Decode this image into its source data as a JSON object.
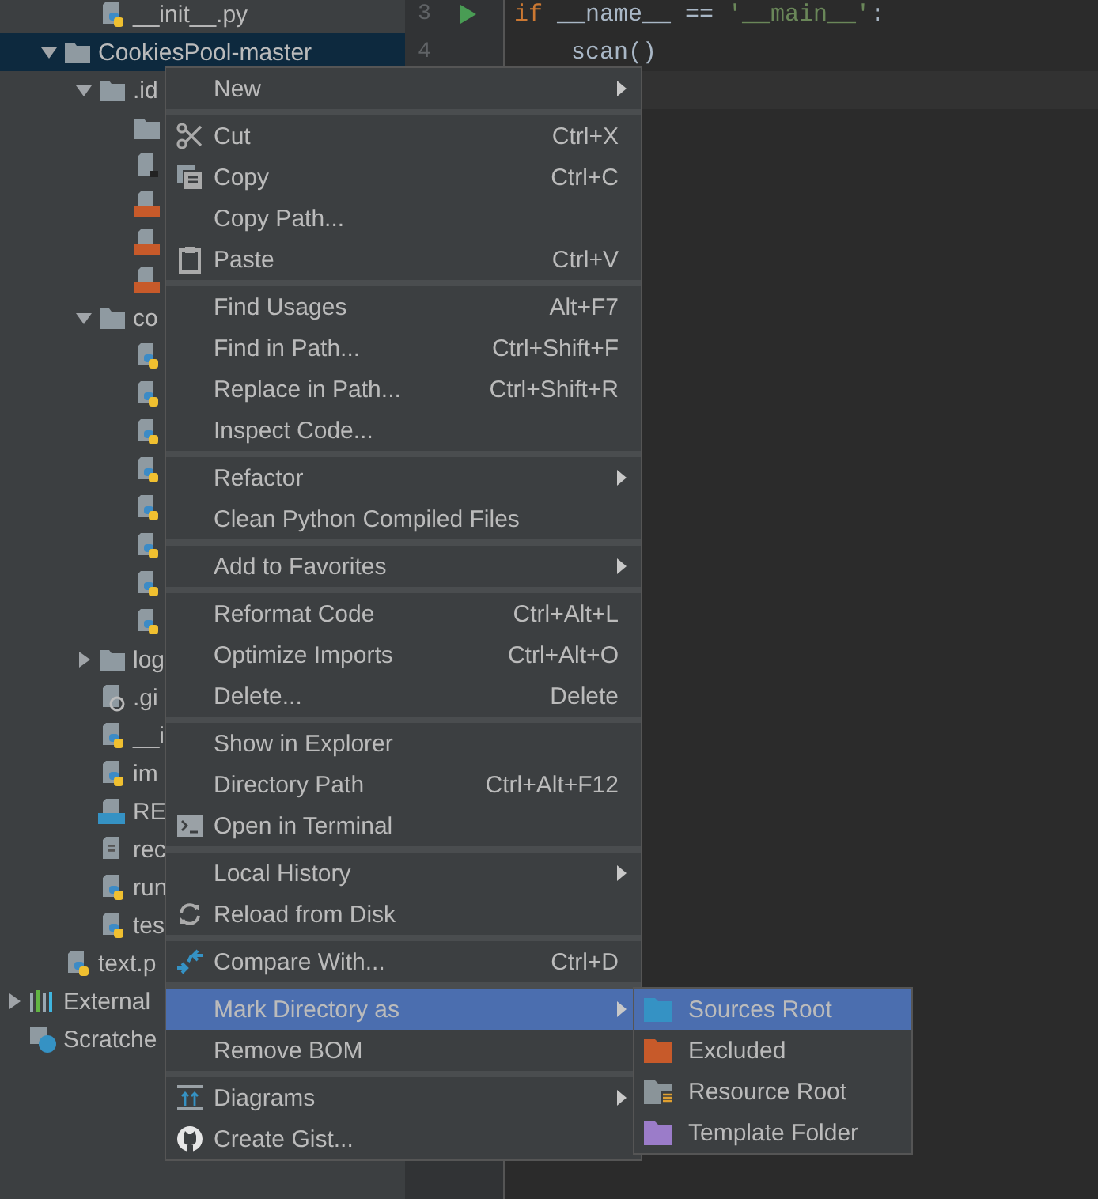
{
  "tree": {
    "items": [
      {
        "children": [
          {
            "children": [
              {
                "label": "__init__.py",
                "kind": "py"
              }
            ]
          },
          {
            "label": "CookiesPool-master",
            "kind": "folder",
            "expanded": true,
            "selected": true,
            "children": [
              {
                "label": ".id",
                "kind": "folder",
                "expanded": true,
                "selected": false,
                "children": [
                  {
                    "kind": "folder",
                    "selected": false
                  },
                  {
                    "kind": "file",
                    "selected": false
                  },
                  {
                    "kind": "xml",
                    "selected": false
                  },
                  {
                    "kind": "xml",
                    "selected": false
                  },
                  {
                    "kind": "xml",
                    "selected": false
                  }
                ]
              },
              {
                "label": "co",
                "kind": "folder",
                "expanded": true,
                "selected": false,
                "children": [
                  {
                    "kind": "py",
                    "selected": false
                  },
                  {
                    "kind": "py",
                    "selected": false
                  },
                  {
                    "kind": "py",
                    "selected": false
                  },
                  {
                    "kind": "py",
                    "selected": false
                  },
                  {
                    "kind": "py",
                    "selected": false
                  },
                  {
                    "kind": "py",
                    "selected": false
                  },
                  {
                    "kind": "py",
                    "selected": false
                  },
                  {
                    "kind": "py",
                    "selected": false
                  }
                ]
              },
              {
                "label": "log",
                "kind": "folder",
                "expanded": false,
                "selected": false
              },
              {
                "label": ".gi",
                "kind": "ignore",
                "selected": false
              },
              {
                "label": "__i",
                "kind": "py",
                "selected": false
              },
              {
                "label": "im",
                "kind": "py",
                "selected": false
              },
              {
                "label": "RE",
                "kind": "md",
                "selected": false
              },
              {
                "label": "rec",
                "kind": "text",
                "selected": false
              },
              {
                "label": "run",
                "kind": "py",
                "selected": false
              },
              {
                "label": "tes",
                "kind": "py",
                "selected": false
              }
            ]
          },
          {
            "label": "text.p",
            "kind": "py",
            "selected": false
          }
        ]
      },
      {
        "label": "External",
        "kind": "library",
        "expanded": false,
        "selected": false
      },
      {
        "label": "Scratche",
        "kind": "scratch",
        "selected": false
      }
    ]
  },
  "editor": {
    "lines": [
      {
        "number": "3",
        "run": true,
        "tokens": [
          {
            "text": "if",
            "kind": "keyword"
          },
          {
            "text": " __name__ ",
            "kind": "name"
          },
          {
            "text": "==",
            "kind": "op"
          },
          {
            "text": " '__main__'",
            "kind": "string"
          },
          {
            "text": ":",
            "kind": "op"
          }
        ]
      },
      {
        "number": "4",
        "tokens": [
          {
            "text": "    scan",
            "kind": "name"
          },
          {
            "text": "()",
            "kind": "op"
          }
        ]
      },
      {
        "current": true
      }
    ]
  },
  "menu": {
    "groups": [
      [
        {
          "label": "New",
          "submenu": true,
          "selected": false
        }
      ],
      [
        {
          "label": "Cut",
          "shortcut": "Ctrl+X",
          "kind": "cut",
          "selected": false
        },
        {
          "label": "Copy",
          "shortcut": "Ctrl+C",
          "kind": "copy",
          "selected": false
        },
        {
          "label": "Copy Path...",
          "selected": false
        },
        {
          "label": "Paste",
          "shortcut": "Ctrl+V",
          "kind": "paste",
          "selected": false
        }
      ],
      [
        {
          "label": "Find Usages",
          "shortcut": "Alt+F7",
          "selected": false
        },
        {
          "label": "Find in Path...",
          "shortcut": "Ctrl+Shift+F",
          "selected": false
        },
        {
          "label": "Replace in Path...",
          "shortcut": "Ctrl+Shift+R",
          "selected": false
        },
        {
          "label": "Inspect Code...",
          "selected": false
        }
      ],
      [
        {
          "label": "Refactor",
          "submenu": true,
          "selected": false
        },
        {
          "label": "Clean Python Compiled Files",
          "selected": false
        }
      ],
      [
        {
          "label": "Add to Favorites",
          "submenu": true,
          "selected": false
        }
      ],
      [
        {
          "label": "Reformat Code",
          "shortcut": "Ctrl+Alt+L",
          "selected": false
        },
        {
          "label": "Optimize Imports",
          "shortcut": "Ctrl+Alt+O",
          "selected": false
        },
        {
          "label": "Delete...",
          "shortcut": "Delete",
          "selected": false
        }
      ],
      [
        {
          "label": "Show in Explorer",
          "selected": false
        },
        {
          "label": "Directory Path",
          "shortcut": "Ctrl+Alt+F12",
          "selected": false
        },
        {
          "label": "Open in Terminal",
          "kind": "terminal",
          "selected": false
        }
      ],
      [
        {
          "label": "Local History",
          "submenu": true,
          "selected": false
        },
        {
          "label": "Reload from Disk",
          "kind": "reload",
          "selected": false
        }
      ],
      [
        {
          "label": "Compare With...",
          "shortcut": "Ctrl+D",
          "kind": "compare",
          "selected": false
        }
      ],
      [
        {
          "label": "Mark Directory as",
          "submenu": true,
          "selected": true
        },
        {
          "label": "Remove BOM",
          "selected": false
        }
      ],
      [
        {
          "label": "Diagrams",
          "submenu": true,
          "kind": "diagram",
          "selected": false
        },
        {
          "label": "Create Gist...",
          "kind": "cat",
          "selected": false
        }
      ]
    ]
  },
  "submenu": {
    "items": [
      {
        "label": "Sources Root",
        "color": "#3592c4",
        "kind": "folder",
        "selected": true
      },
      {
        "label": "Excluded",
        "color": "#c75a2a",
        "kind": "folder",
        "selected": false
      },
      {
        "label": "Resource Root",
        "color": "#8a9499",
        "kind": "resource",
        "selected": false
      },
      {
        "label": "Template Folder",
        "color": "#9b7cc9",
        "kind": "folder",
        "selected": false
      }
    ]
  }
}
